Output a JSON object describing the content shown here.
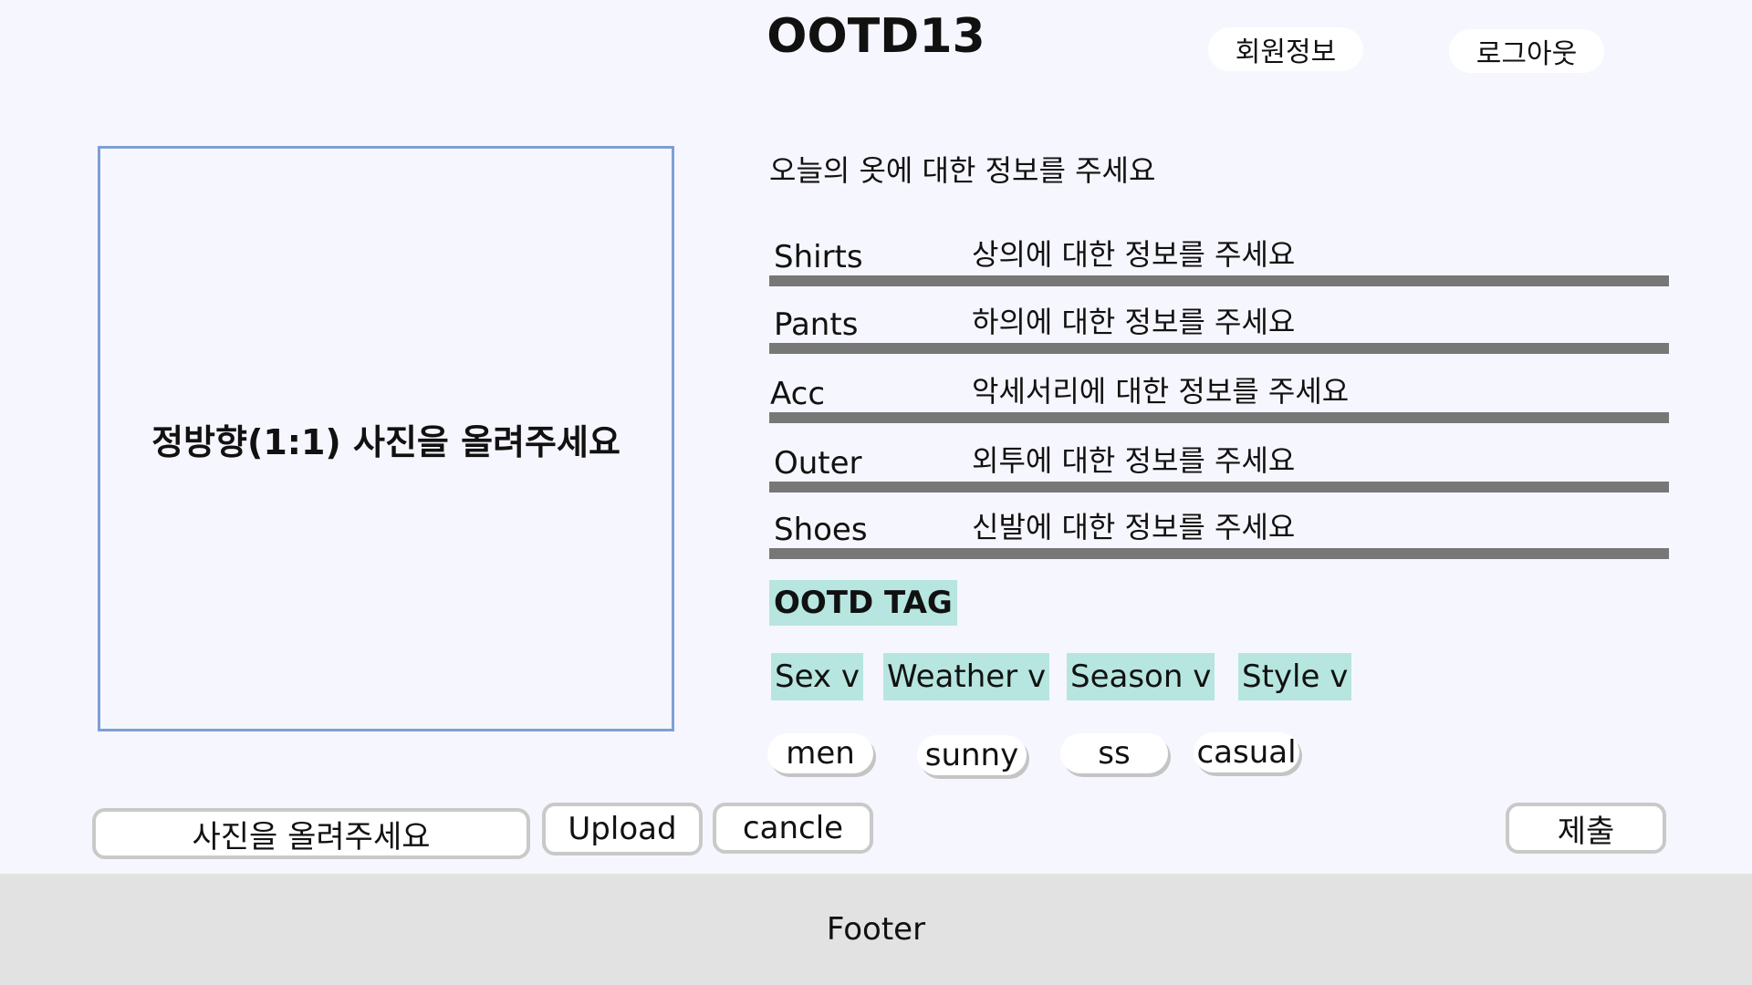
{
  "header": {
    "logo": "OOTD13",
    "member_info": "회원정보",
    "logout": "로그아웃"
  },
  "photo": {
    "prompt": "정방향(1:1) 사진을 올려주세요"
  },
  "form": {
    "intro": "오늘의 옷에 대한 정보를 주세요",
    "fields": [
      {
        "label": "Shirts",
        "placeholder": "상의에 대한 정보를 주세요"
      },
      {
        "label": "Pants",
        "placeholder": "하의에 대한 정보를 주세요"
      },
      {
        "label": "Acc",
        "placeholder": "악세서리에 대한 정보를 주세요"
      },
      {
        "label": "Outer",
        "placeholder": "외투에 대한 정보를 주세요"
      },
      {
        "label": "Shoes",
        "placeholder": "신발에 대한 정보를 주세요"
      }
    ]
  },
  "tags": {
    "title": "OOTD TAG",
    "filters": [
      "Sex v",
      "Weather v",
      "Season v",
      "Style v"
    ],
    "chips": [
      "men",
      "sunny",
      "ss",
      "casual"
    ],
    "highlight_color": "#b6e6df"
  },
  "actions": {
    "file_field": "사진을 올려주세요",
    "upload": "Upload",
    "cancel": "cancle",
    "submit": "제출"
  },
  "footer": {
    "text": "Footer"
  }
}
